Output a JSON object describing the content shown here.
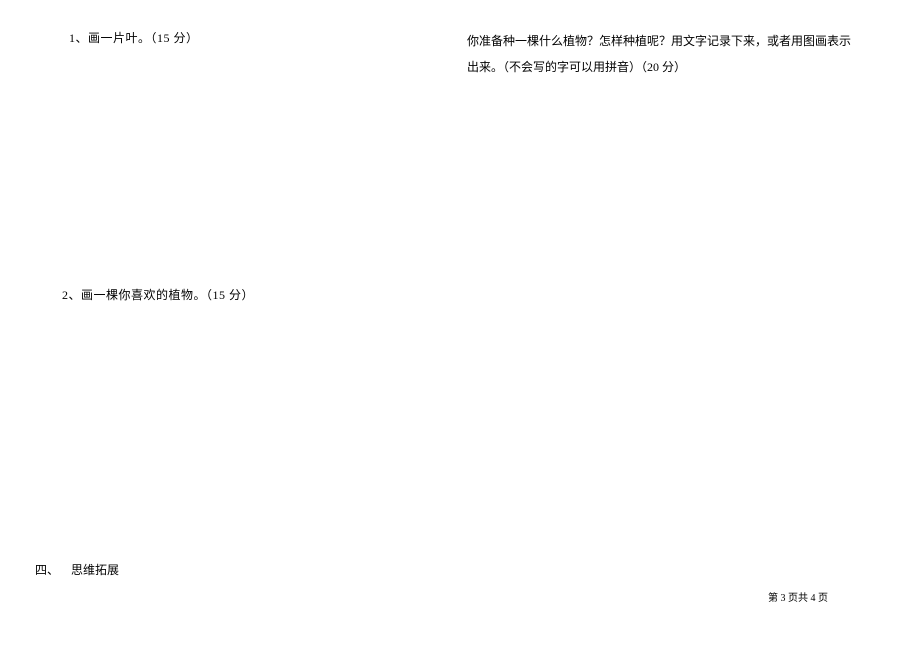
{
  "questions": {
    "q1": "1、画一片叶。（15 分）",
    "q2": "2、画一棵你喜欢的植物。（15 分）"
  },
  "section4": {
    "number": "四、",
    "title": "思维拓展"
  },
  "rightColumn": {
    "text": "你准备种一棵什么植物？怎样种植呢？用文字记录下来，或者用图画表示出来。（不会写的字可以用拼音）（20 分）"
  },
  "footer": {
    "pageInfo": "第 3 页共 4 页"
  }
}
